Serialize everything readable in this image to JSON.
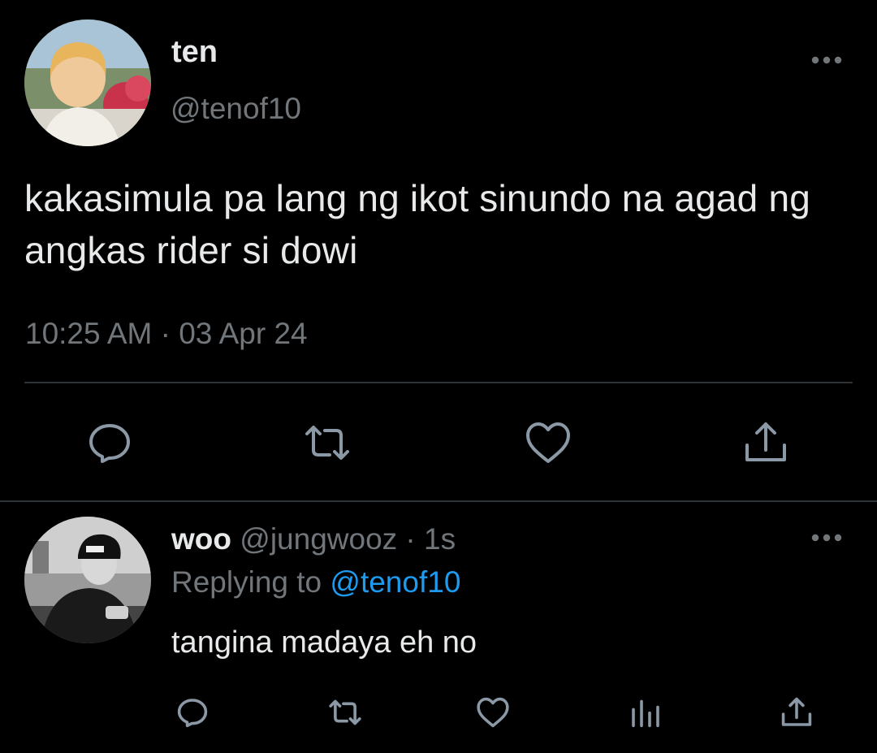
{
  "tweet": {
    "author_name": "ten",
    "author_handle": "@tenof10",
    "avatar_icon": "avatar-photo",
    "text": "kakasimula pa lang ng ikot sinundo na agad ng angkas rider si dowi",
    "timestamp": "10:25 AM · 03 Apr 24",
    "more_icon": "ellipsis-icon",
    "actions": [
      "reply-icon",
      "retweet-icon",
      "like-icon",
      "share-icon"
    ]
  },
  "reply": {
    "author_name": "woo",
    "author_handle": "@jungwooz",
    "time_sep": " · ",
    "relative_time": "1s",
    "replying_prefix": "Replying to ",
    "replying_to": "@tenof10",
    "text": "tangina madaya eh no",
    "more_icon": "ellipsis-icon",
    "actions": [
      "reply-icon",
      "retweet-icon",
      "like-icon",
      "views-icon",
      "share-icon"
    ]
  },
  "colors": {
    "background": "#000000",
    "text_primary": "#e7e9ea",
    "text_secondary": "#71767b",
    "accent": "#1d9bf0",
    "divider": "#2f3336"
  }
}
